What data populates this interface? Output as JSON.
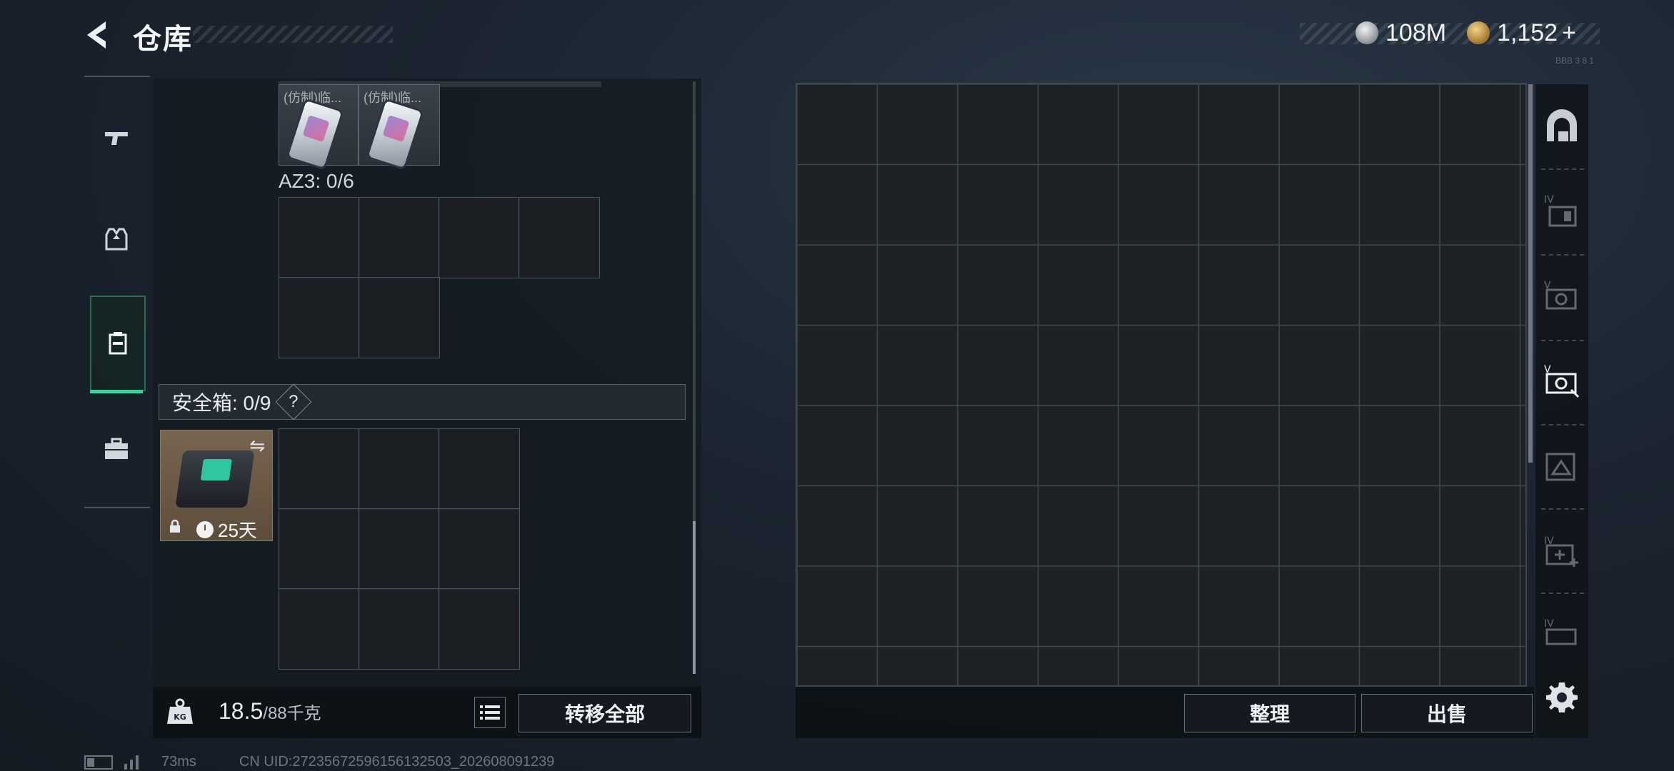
{
  "header": {
    "title": "仓库",
    "currency_silver": "108M",
    "currency_gold": "1,152",
    "add_symbol": "+",
    "tiny_text": "BBB 3 8 1"
  },
  "left_sections": {
    "top_items": [
      {
        "caption": "(仿制)临..."
      },
      {
        "caption": "(仿制)临..."
      }
    ],
    "az3_label": "AZ3: 0/6",
    "safe_label": "安全箱: 0/9",
    "safe_help": "?",
    "safebox_timer": "25天",
    "swap_symbol": "⇋"
  },
  "bottom_left": {
    "weight_value": "18.5",
    "weight_max": "/88千克",
    "transfer_all": "转移全部"
  },
  "bottom_right": {
    "arrange": "整理",
    "sell": "出售"
  },
  "status": {
    "ping": "73ms",
    "uid": "CN UID:27235672596156132503_202608091239"
  },
  "colors": {
    "accent_green": "#3ed39a",
    "background": "#1b2430"
  }
}
